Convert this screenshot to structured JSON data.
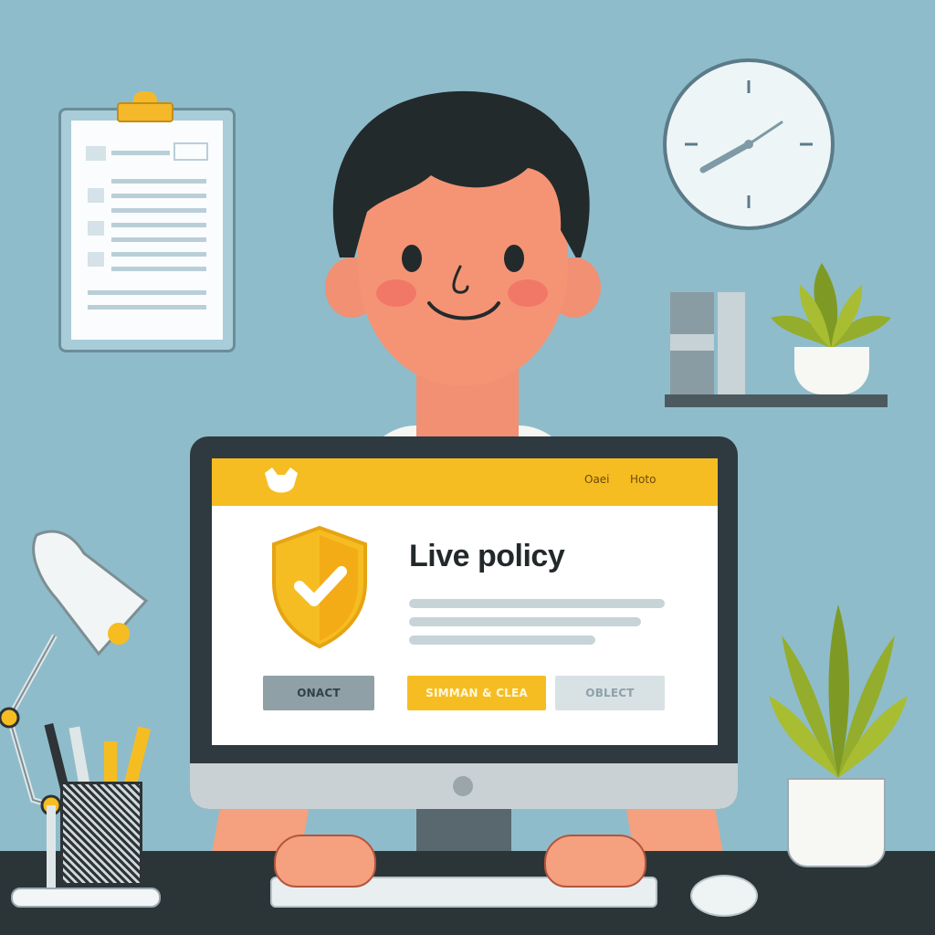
{
  "app": {
    "nav": [
      "Oaei",
      "Hoto"
    ],
    "title": "Live policy",
    "buttons": [
      "ONACT",
      "SIMMAN & CLEA",
      "OBLECT"
    ]
  },
  "icons": {
    "logo": "cat-logo-icon",
    "shield": "shield-check-icon",
    "clock": "wall-clock-icon",
    "clipboard": "clipboard-icon",
    "lamp": "desk-lamp-icon",
    "plant": "plant-icon"
  },
  "colors": {
    "accent": "#f6bd22",
    "background": "#8fbcca",
    "skin": "#f59474",
    "hair": "#232a2c"
  }
}
